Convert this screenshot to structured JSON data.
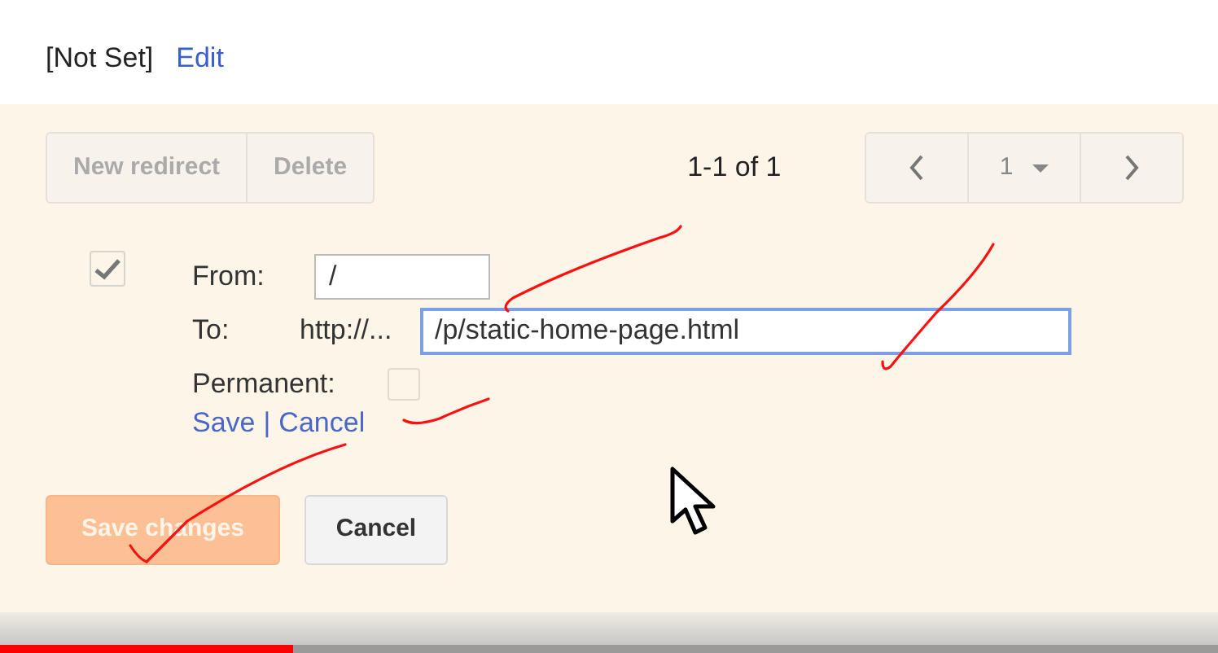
{
  "header": {
    "value": "[Not Set]",
    "edit_link": "Edit"
  },
  "toolbar": {
    "buttons": [
      {
        "label": "New redirect",
        "disabled": true
      },
      {
        "label": "Delete",
        "disabled": true
      }
    ],
    "range": "1-1 of 1",
    "page": "1"
  },
  "redirect": {
    "selected": true,
    "from_label": "From:",
    "from_value": "/",
    "to_label": "To:",
    "to_prefix": "http://...",
    "to_value": "/p/static-home-page.html",
    "permanent_label": "Permanent:",
    "permanent": false,
    "save_link": "Save",
    "separator": "|",
    "cancel_link": "Cancel"
  },
  "actions": [
    {
      "label": "Save changes",
      "kind": "primary",
      "disabled": true
    },
    {
      "label": "Cancel",
      "kind": "secondary",
      "disabled": false
    }
  ],
  "video_progress": {
    "level": 0.24
  }
}
